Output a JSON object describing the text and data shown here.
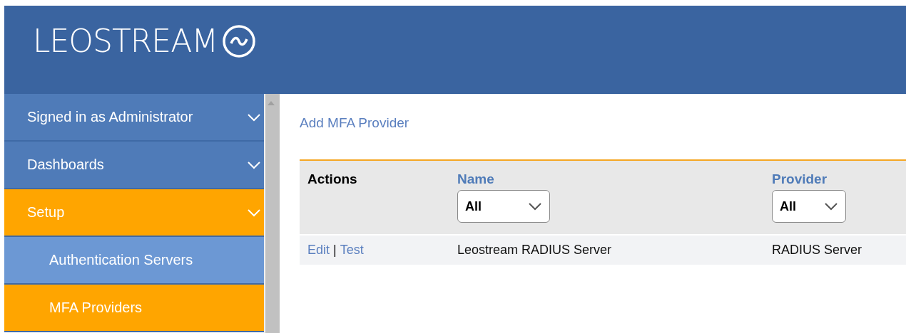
{
  "header": {
    "logo": "LEOSTREAM"
  },
  "sidebar": {
    "items": [
      {
        "label": "Signed in as Administrator",
        "selected": false
      },
      {
        "label": "Dashboards",
        "selected": false
      },
      {
        "label": "Setup",
        "selected": true,
        "children": [
          {
            "label": "Authentication Servers",
            "selected": false
          },
          {
            "label": "MFA Providers",
            "selected": true
          }
        ]
      }
    ]
  },
  "add_link": "Add MFA Provider",
  "table": {
    "columns": [
      {
        "label": "Actions",
        "kind": "plain"
      },
      {
        "label": "Name",
        "kind": "filter",
        "filter": "All"
      },
      {
        "label": "Provider",
        "kind": "filter",
        "filter": "All"
      }
    ],
    "rows": [
      {
        "actions": [
          "Edit",
          "Test"
        ],
        "separator": "|",
        "name": "Leostream RADIUS Server",
        "provider": "RADIUS Server"
      }
    ]
  }
}
